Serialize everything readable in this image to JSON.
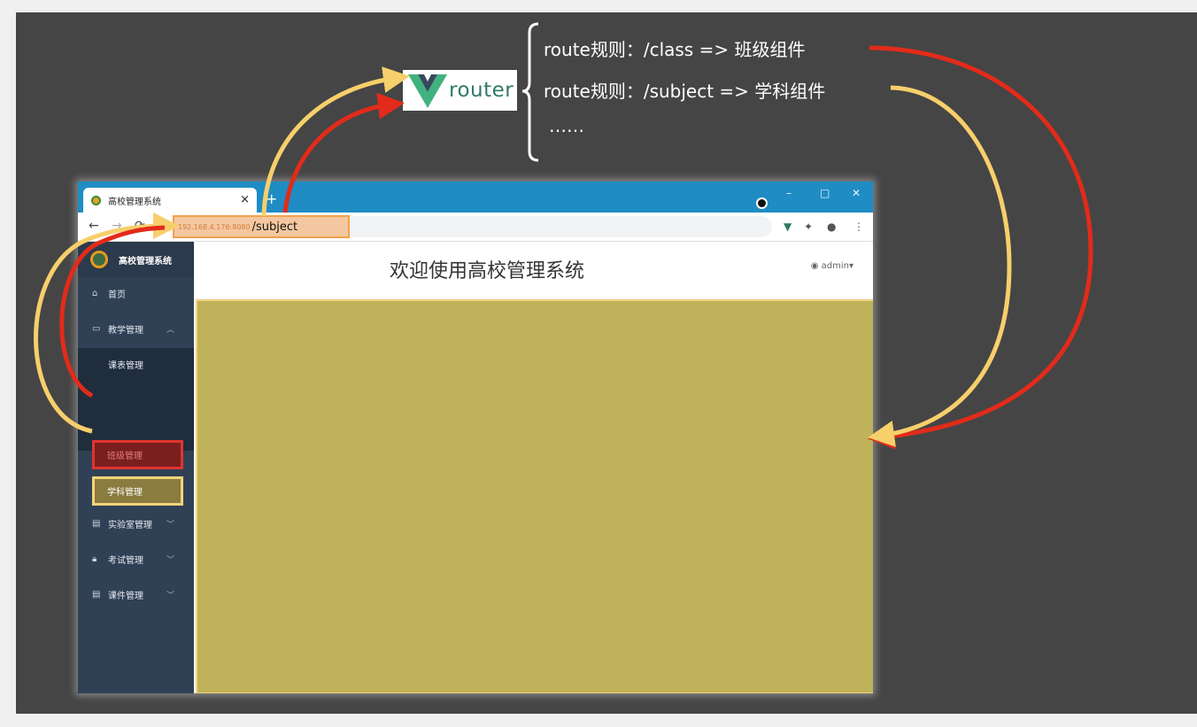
{
  "router": {
    "logo_text": "router",
    "rules": [
      "route规则：/class =>  班级组件",
      "route规则：/subject => 学科组件",
      "……"
    ]
  },
  "browser": {
    "tab_title": "高校管理系统",
    "tab_close": "×",
    "new_tab": "+",
    "url_host": "192.168.4.176:8080",
    "url_path": "/subject",
    "window_controls": [
      "–",
      "□",
      "✕"
    ]
  },
  "app": {
    "logo_title": "高校管理系统",
    "welcome": "欢迎使用高校管理系统",
    "user": "admin",
    "menu": [
      {
        "label": "首页",
        "icon": "home-icon"
      },
      {
        "label": "教学管理",
        "icon": "monitor-icon",
        "expanded": true
      },
      {
        "label": "实验室管理",
        "icon": "doc-icon"
      },
      {
        "label": "考试管理",
        "icon": "lock-icon"
      },
      {
        "label": "课件管理",
        "icon": "doc-icon"
      }
    ],
    "submenu": [
      "课表管理",
      "班级管理",
      "学科管理"
    ]
  },
  "colors": {
    "red_arrow": "#e22b1a",
    "yellow_arrow": "#f7cf6b",
    "content_bg": "#c0b25b",
    "sidebar_bg": "#304156",
    "titlebar": "#1f8cc4"
  }
}
